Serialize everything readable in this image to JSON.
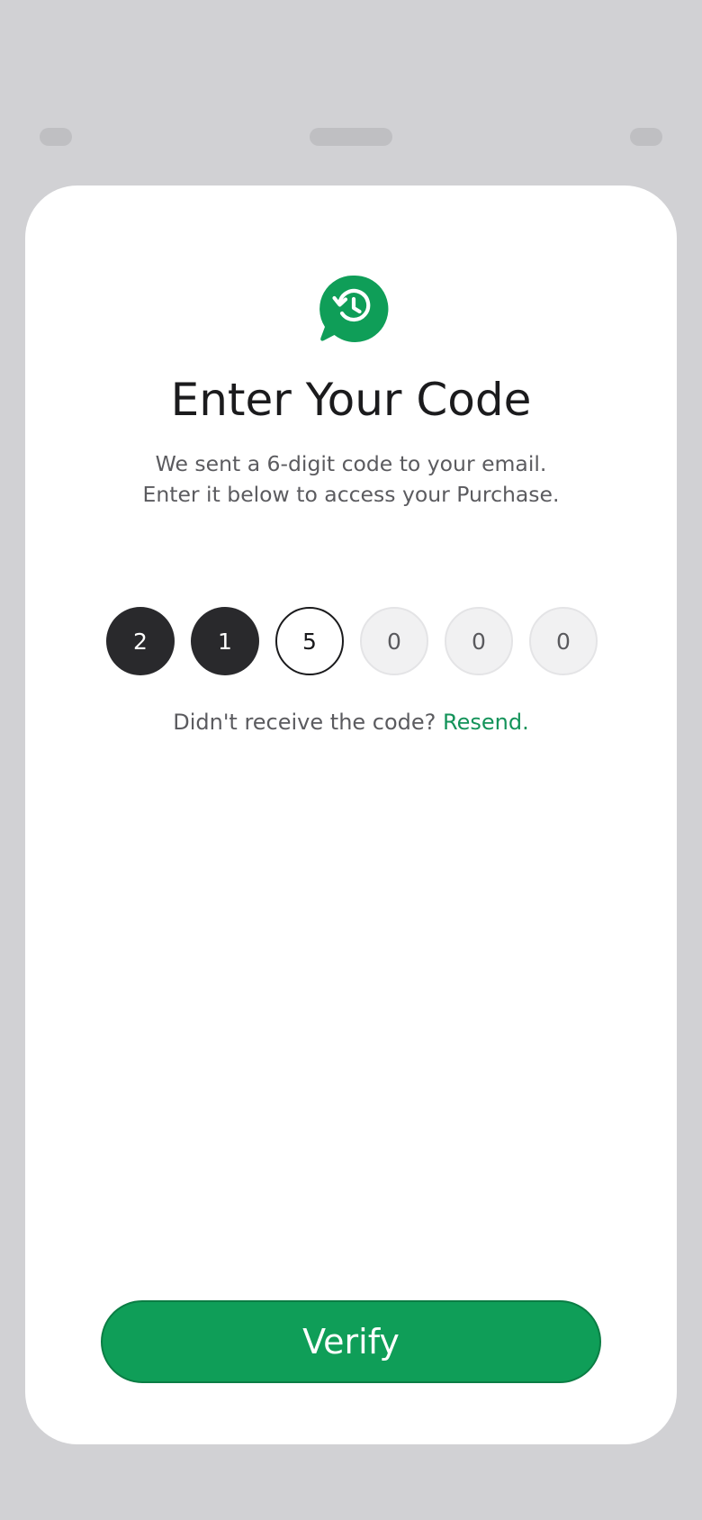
{
  "colors": {
    "background": "#d1d1d4",
    "card": "#ffffff",
    "accent": "#0f9e58",
    "link": "#14935a",
    "filled_digit": "#29292c"
  },
  "header": {
    "icon": "history-chat-icon",
    "title": "Enter Your Code",
    "subtitle": "We sent a 6-digit code to your email. Enter it below to access your Purchase."
  },
  "code": {
    "digits": [
      {
        "value": "2",
        "state": "filled"
      },
      {
        "value": "1",
        "state": "filled"
      },
      {
        "value": "5",
        "state": "active"
      },
      {
        "value": "0",
        "state": "empty"
      },
      {
        "value": "0",
        "state": "empty"
      },
      {
        "value": "0",
        "state": "empty"
      }
    ]
  },
  "resend": {
    "prompt": "Didn't receive the code? ",
    "link_label": "Resend."
  },
  "actions": {
    "verify_label": "Verify"
  }
}
